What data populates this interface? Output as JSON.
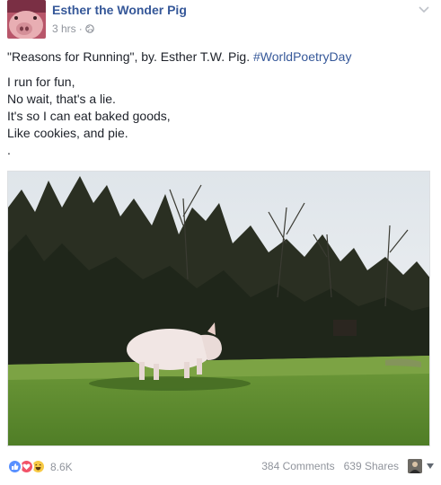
{
  "post": {
    "author": "Esther the Wonder Pig",
    "timestamp": "3 hrs",
    "separator": "·",
    "audience_icon": "globe-icon",
    "menu_icon": "chevron-down-icon",
    "caption_text": "\"Reasons for Running\", by. Esther T.W. Pig. ",
    "hashtag": "#WorldPoetryDay",
    "poem_lines": [
      "I run for fun,",
      "No wait, that's a lie.",
      "It's so I can eat baked goods,",
      "Like cookies, and pie.",
      "."
    ],
    "media_description_icon": "video-thumbnail"
  },
  "footer": {
    "reaction_icons": [
      "like-icon",
      "love-icon",
      "haha-icon"
    ],
    "reaction_count": "8.6K",
    "comments": "384 Comments",
    "shares": "639 Shares"
  },
  "colors": {
    "link": "#365899",
    "meta": "#90949c",
    "like": "#5890ff",
    "love": "#f25268",
    "haha": "#f7c944"
  }
}
